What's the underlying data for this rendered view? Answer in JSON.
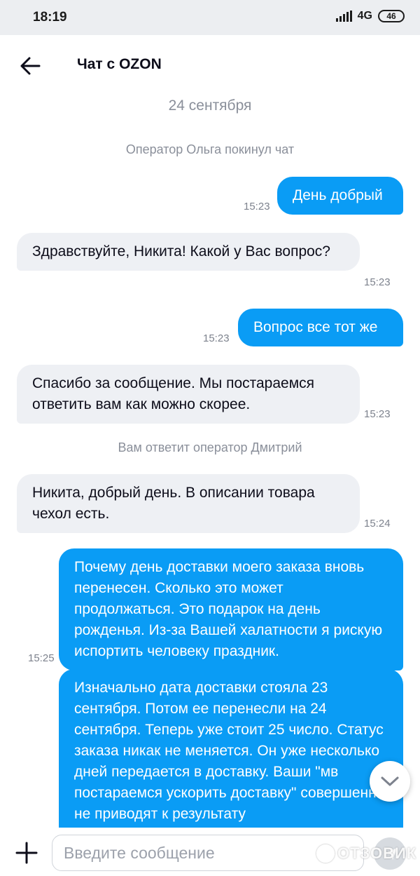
{
  "status_bar": {
    "time": "18:19",
    "network": "4G",
    "battery": "46",
    "icons": [
      "signal-icon",
      "battery-icon"
    ]
  },
  "header": {
    "back_icon": "arrow-left-icon",
    "title": "Чат с OZON"
  },
  "chat": {
    "date": "24 сентября",
    "messages": [
      {
        "type": "system",
        "text": "Оператор Ольга покинул чат"
      },
      {
        "type": "out",
        "text": "День добрый",
        "time": "15:23"
      },
      {
        "type": "in",
        "text": "Здравствуйте, Никита! Какой у Вас вопрос?",
        "time": "15:23"
      },
      {
        "type": "out",
        "text": "Вопрос все тот же",
        "time": "15:23"
      },
      {
        "type": "in",
        "text": "Спасибо за сообщение. Мы постараемся ответить вам как можно скорее.",
        "time": "15:23"
      },
      {
        "type": "system",
        "text": "Вам ответит оператор Дмитрий"
      },
      {
        "type": "in",
        "text": "Никита, добрый день. В описании товара чехол есть.",
        "time": "15:24"
      },
      {
        "type": "out",
        "text": "Почему день доставки моего заказа вновь перенесен. Сколько это может продолжаться. Это подарок на день рожденья. Из-за Вашей халатности я рискую испортить человеку праздник.",
        "time": "15:25"
      },
      {
        "type": "out",
        "text": "Изначально дата доставки  стояла 23 сентября. Потом ее перенесли на 24 сентября. Теперь уже стоит 25 число. Статус заказа никак не меняется. Он уже несколько дней передается в доставку. Ваши \"мв постараемся ускорить доставку\" совершенно не приводят к результату",
        "time": ""
      }
    ]
  },
  "scroll_down_icon": "chevron-down-icon",
  "composer": {
    "attach_icon": "plus-icon",
    "placeholder": "Введите сообщение",
    "value": "",
    "send_icon": "send-arrow-icon"
  },
  "watermark": "ОТЗОВИК",
  "colors": {
    "accent": "#0a9cf5",
    "incoming_bubble": "#eef0f4",
    "muted_text": "#8a8f9a",
    "status_bar": "#eceef1"
  }
}
